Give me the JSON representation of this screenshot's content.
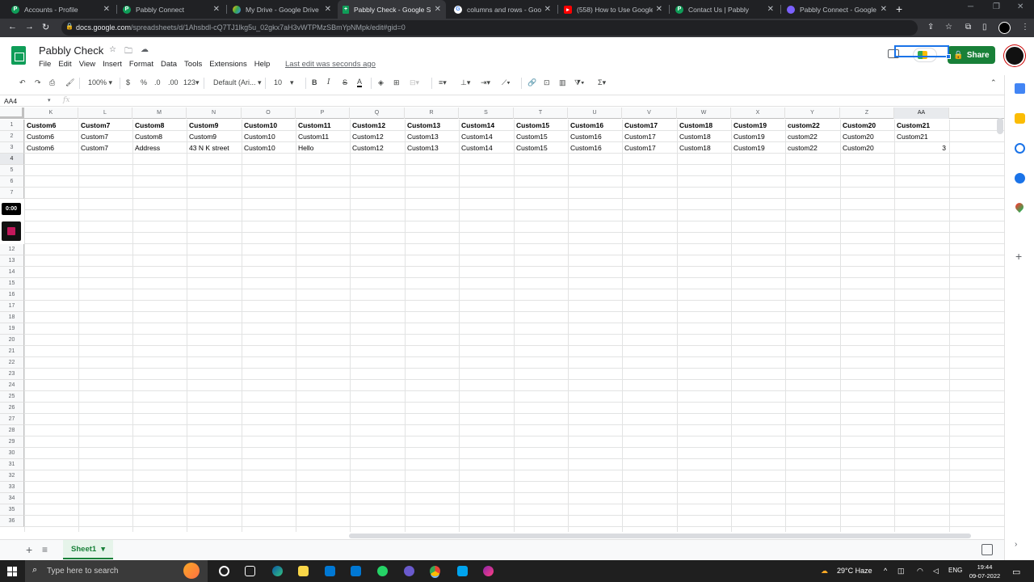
{
  "browser": {
    "tabs": [
      {
        "title": "Accounts - Profile",
        "favicon_color": "#0f9d58",
        "active": false
      },
      {
        "title": "Pabbly Connect",
        "favicon_color": "#0f9d58",
        "active": false
      },
      {
        "title": "My Drive - Google Drive",
        "favicon_color": "#fbbc04",
        "active": false
      },
      {
        "title": "Pabbly Check - Google Sh",
        "favicon_color": "#0f9d58",
        "active": true
      },
      {
        "title": "columns and rows - Goog",
        "favicon_color": "#ffffff",
        "active": false
      },
      {
        "title": "(558) How to Use Google",
        "favicon_color": "#ff0000",
        "active": false
      },
      {
        "title": "Contact Us | Pabbly",
        "favicon_color": "#0f9d58",
        "active": false
      },
      {
        "title": "Pabbly Connect - Google",
        "favicon_color": "#7b61ff",
        "active": false
      }
    ],
    "url_host": "docs.google.com",
    "url_path": "/spreadsheets/d/1Ahsbdl-cQ7TJ1lkg5u_02gkx7aH3vWTPMzSBmYpNMpk/edit#gid=0"
  },
  "doc": {
    "title": "Pabbly Check",
    "menu": [
      "File",
      "Edit",
      "View",
      "Insert",
      "Format",
      "Data",
      "Tools",
      "Extensions",
      "Help"
    ],
    "last_edit": "Last edit was seconds ago",
    "share_label": "Share"
  },
  "toolbar": {
    "zoom": "100%",
    "currency": "$",
    "percent": "%",
    "dec_less": ".0",
    "dec_more": ".00",
    "format_more": "123",
    "font": "Default (Ari...",
    "font_size": "10"
  },
  "formula": {
    "name_box": "AA4",
    "fx": "fx"
  },
  "grid": {
    "columns": [
      "K",
      "L",
      "M",
      "N",
      "O",
      "P",
      "Q",
      "R",
      "S",
      "T",
      "U",
      "V",
      "W",
      "X",
      "Y",
      "Z",
      "AA"
    ],
    "selected_column": "AA",
    "selected_row": "4",
    "rows_top": [
      "1",
      "2",
      "3",
      "4",
      "5",
      "6",
      "7"
    ],
    "rows_bottom": [
      "12",
      "13",
      "14",
      "15",
      "16",
      "17",
      "18",
      "19",
      "20",
      "21",
      "22",
      "23",
      "24",
      "25",
      "26",
      "27",
      "28",
      "29",
      "30",
      "31",
      "32",
      "33",
      "34",
      "35",
      "36"
    ],
    "row1": [
      "Custom6",
      "Custom7",
      "Custom8",
      "Custom9",
      "Custom10",
      "Custom11",
      "Custom12",
      "Custom13",
      "Custom14",
      "Custom15",
      "Custom16",
      "Custom17",
      "Custom18",
      "Custom19",
      "custom22",
      "Custom20",
      "Custom21"
    ],
    "row2": [
      "Custom6",
      "Custom7",
      "Custom8",
      "Custom9",
      "Custom10",
      "Custom11",
      "Custom12",
      "Custom13",
      "Custom14",
      "Custom15",
      "Custom16",
      "Custom17",
      "Custom18",
      "Custom19",
      "custom22",
      "Custom20",
      "Custom21"
    ],
    "row3": [
      "Custom6",
      "Custom7",
      "Address",
      "43 N K street",
      "Custom10",
      "Hello",
      "Custom12",
      "Custom13",
      "Custom14",
      "Custom15",
      "Custom16",
      "Custom17",
      "Custom18",
      "Custom19",
      "custom22",
      "Custom20",
      "3"
    ]
  },
  "recorder": {
    "time": "0:00"
  },
  "sheets": {
    "active_tab": "Sheet1"
  },
  "taskbar": {
    "search_placeholder": "Type here to search",
    "weather": "29°C  Haze",
    "lang": "ENG",
    "time": "19:44",
    "date": "09-07-2022"
  }
}
